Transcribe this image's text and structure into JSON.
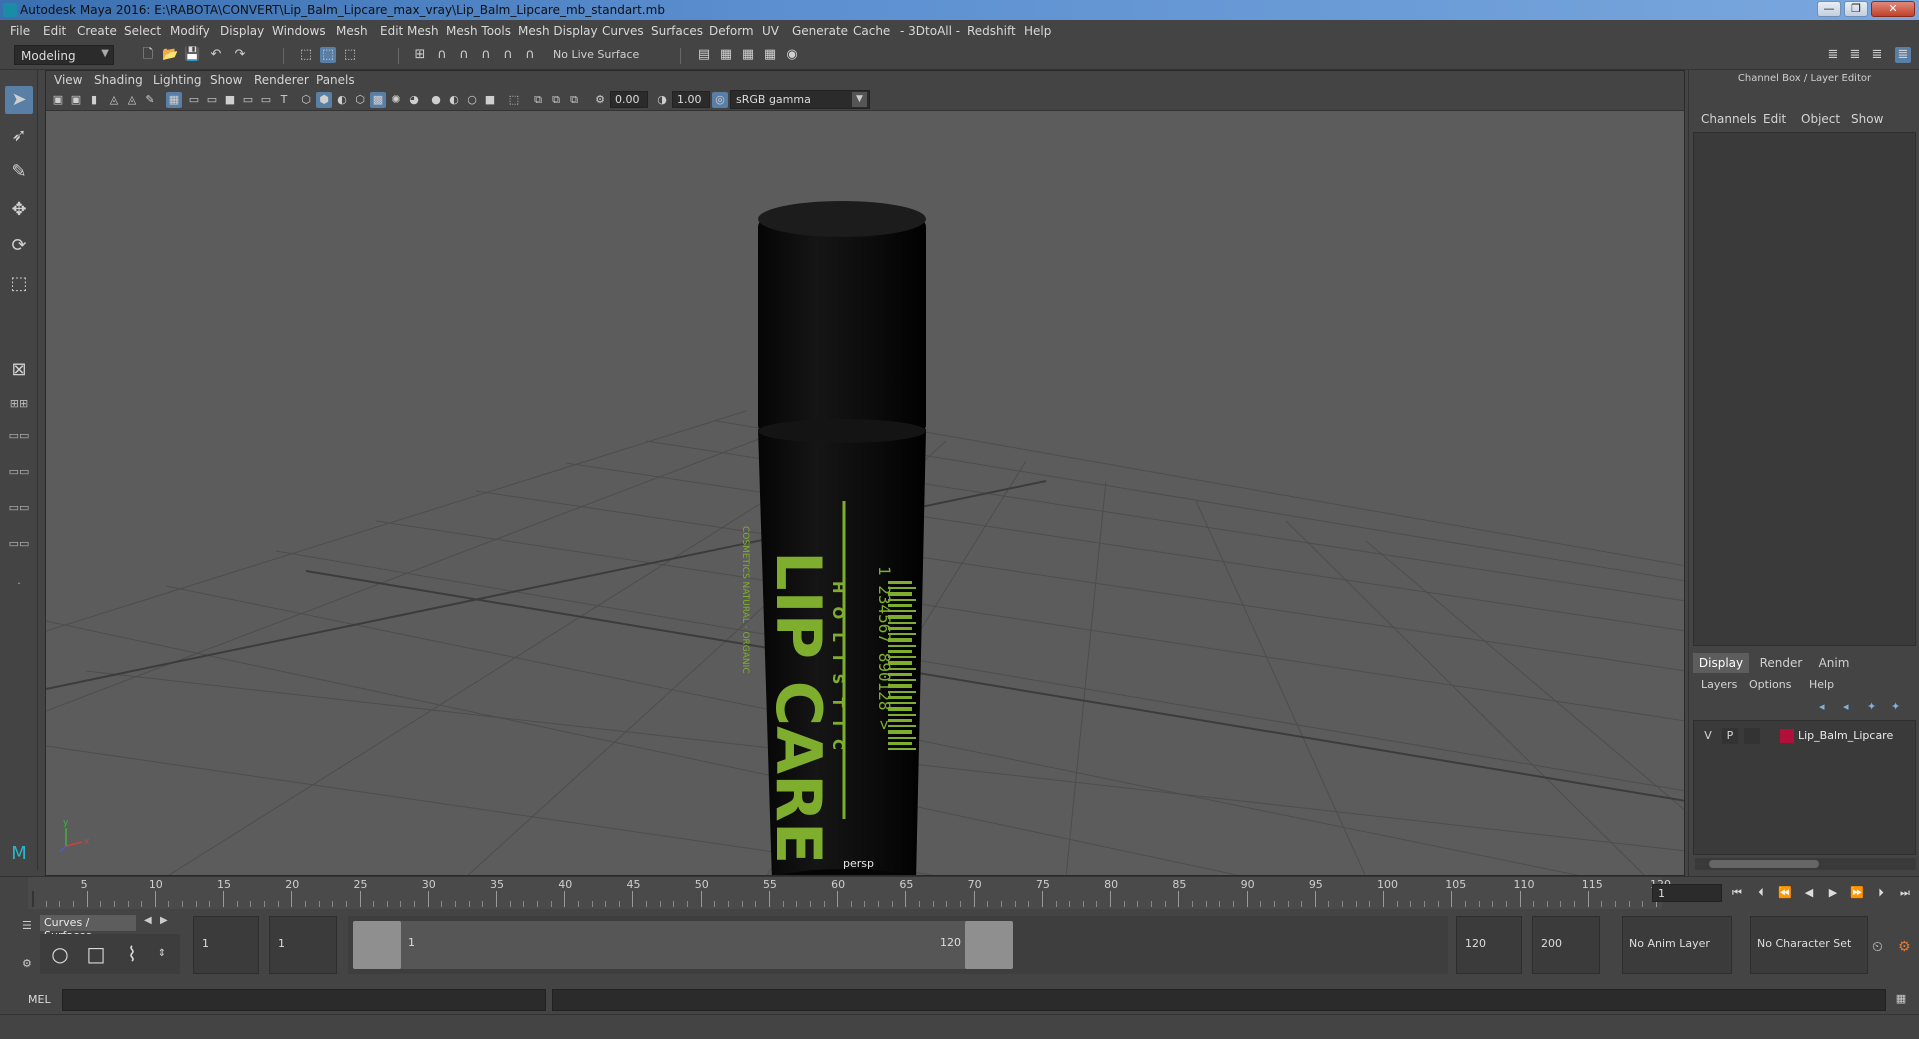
{
  "window": {
    "title": "Autodesk Maya 2016: E:\\RABOTA\\CONVERT\\Lip_Balm_Lipcare_max_vray\\Lip_Balm_Lipcare_mb_standart.mb",
    "minimize": "—",
    "maximize": "❐",
    "close": "✕"
  },
  "menubar": [
    "File",
    "Edit",
    "Create",
    "Select",
    "Modify",
    "Display",
    "Windows",
    "Mesh",
    "Edit Mesh",
    "Mesh Tools",
    "Mesh Display",
    "Curves",
    "Surfaces",
    "Deform",
    "UV",
    "Generate",
    "Cache",
    "- 3DtoAll -",
    "Redshift",
    "Help"
  ],
  "statusline": {
    "mode": "Modeling",
    "live_surface": "No Live Surface"
  },
  "viewport": {
    "menus": [
      "View",
      "Shading",
      "Lighting",
      "Show",
      "Renderer",
      "Panels"
    ],
    "exposure": "0.00",
    "gamma": "1.00",
    "color_space": "sRGB gamma",
    "camera_label": "persp",
    "axis_x": "x",
    "axis_y": "y"
  },
  "product_label": {
    "brand_line": "HOLISTIC",
    "name": "LIP CARE",
    "side_text": "COSMETICS NATURAL · ORGANIC",
    "barcode_digits": "1 234567 890128 >",
    "label_color": "#7fae2f",
    "tube_color": "#0a0a0a"
  },
  "rightpanel": {
    "title": "Channel Box / Layer Editor",
    "channel_tabs": [
      "Channels",
      "Edit",
      "Object",
      "Show"
    ],
    "layer_tabs": [
      "Display",
      "Render",
      "Anim"
    ],
    "layer_menu": [
      "Layers",
      "Options",
      "Help"
    ],
    "layer": {
      "visible": "V",
      "playback": "P",
      "name": "Lip_Balm_Lipcare",
      "color": "#b0103a"
    }
  },
  "timeslider": {
    "ticks": [
      "5",
      "10",
      "15",
      "20",
      "25",
      "30",
      "35",
      "40",
      "45",
      "50",
      "55",
      "60",
      "65",
      "70",
      "75",
      "80",
      "85",
      "90",
      "95",
      "100",
      "105",
      "110",
      "115",
      "120"
    ],
    "current_frame": "1",
    "frame_field": "1"
  },
  "rangebar": {
    "shelf_tab": "Curves / Surfaces",
    "start": "1",
    "playback_start": "1",
    "range_start": "1",
    "range_end": "120",
    "playback_end": "120",
    "end": "200",
    "anim_layer": "No Anim Layer",
    "character_set": "No Character Set"
  },
  "cmdline": {
    "label": "MEL"
  }
}
